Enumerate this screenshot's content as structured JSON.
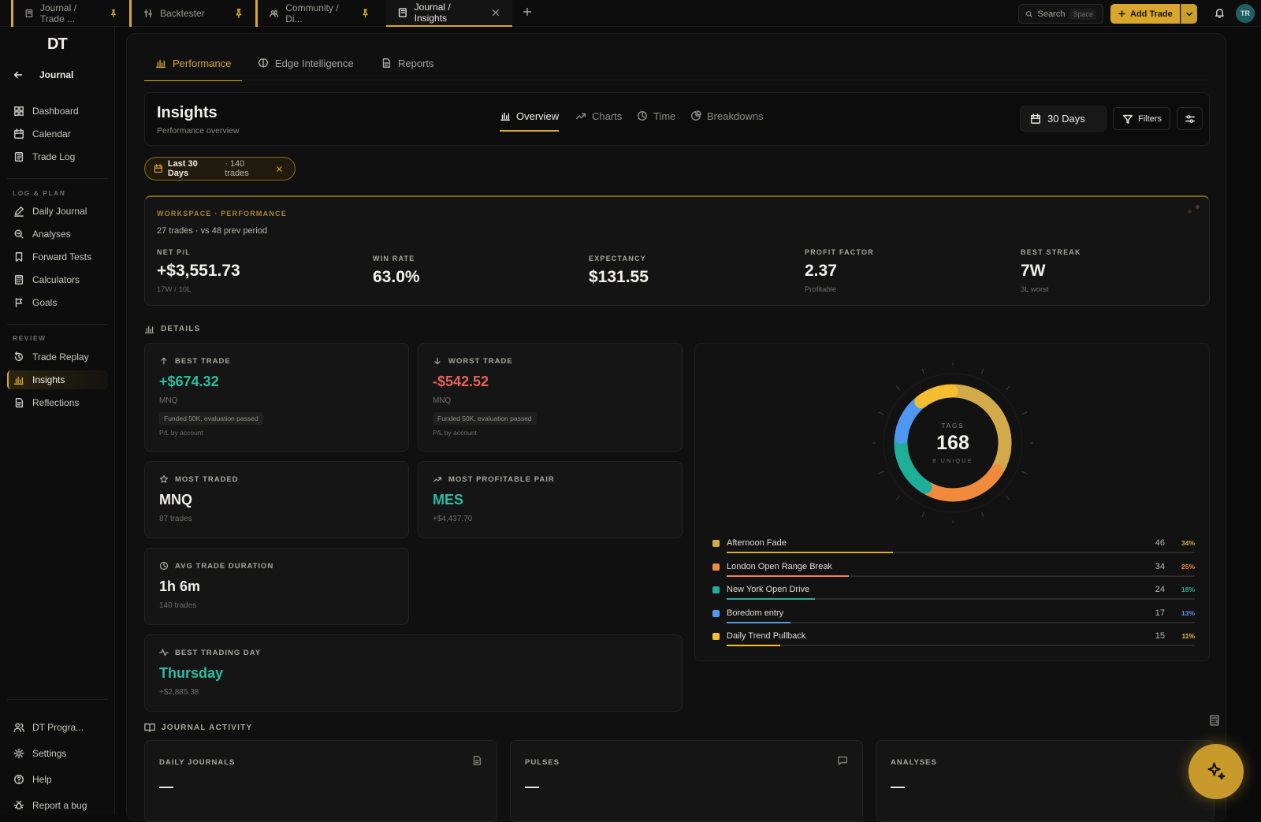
{
  "tabs": [
    {
      "label": "Journal / Trade ...",
      "icon": "journal-icon"
    },
    {
      "label": "Backtester",
      "icon": "backtest-icon"
    },
    {
      "label": "Community / Di...",
      "icon": "community-icon"
    },
    {
      "label": "Journal / Insights",
      "icon": "journal-icon",
      "active": true
    }
  ],
  "topbar": {
    "search_label": "Search",
    "search_kbd": "Space",
    "add_trade": "Add Trade",
    "avatar": "TR"
  },
  "sidebar": {
    "logo": "DT",
    "back_label": "Journal",
    "items": [
      {
        "label": "Dashboard",
        "icon": "dashboard-icon"
      },
      {
        "label": "Calendar",
        "icon": "calendar-icon"
      },
      {
        "label": "Trade Log",
        "icon": "book-icon"
      }
    ],
    "section_log": "LOG & PLAN",
    "log_items": [
      {
        "label": "Daily Journal",
        "icon": "pencil-icon"
      },
      {
        "label": "Analyses",
        "icon": "analysis-icon"
      },
      {
        "label": "Forward Tests",
        "icon": "bookmark-icon"
      },
      {
        "label": "Calculators",
        "icon": "calculator-icon"
      },
      {
        "label": "Goals",
        "icon": "flag-icon"
      }
    ],
    "section_review": "REVIEW",
    "review_items": [
      {
        "label": "Trade Replay",
        "icon": "replay-icon"
      },
      {
        "label": "Insights",
        "icon": "bar-chart-icon",
        "active": true
      },
      {
        "label": "Reflections",
        "icon": "document-icon"
      }
    ],
    "bottom_items": [
      {
        "label": "DT Progra...",
        "icon": "users-icon"
      },
      {
        "label": "Settings",
        "icon": "gear-icon"
      },
      {
        "label": "Help",
        "icon": "help-icon"
      },
      {
        "label": "Report a bug",
        "icon": "bug-icon"
      }
    ]
  },
  "page_tabs": [
    {
      "label": "Performance",
      "icon": "bar-chart-icon",
      "active": true
    },
    {
      "label": "Edge Intelligence",
      "icon": "brain-icon"
    },
    {
      "label": "Reports",
      "icon": "document-icon"
    }
  ],
  "insights": {
    "title": "Insights",
    "subtitle": "Performance overview",
    "subtabs": [
      {
        "label": "Overview",
        "icon": "bar-chart-icon",
        "active": true
      },
      {
        "label": "Charts",
        "icon": "trend-icon"
      },
      {
        "label": "Time",
        "icon": "clock-icon"
      },
      {
        "label": "Breakdowns",
        "icon": "pie-icon"
      }
    ],
    "range": "30 Days",
    "filters": "Filters"
  },
  "chip": {
    "label": "Last 30 Days",
    "detail": "· 140 trades"
  },
  "performance": {
    "kicker": "WORKSPACE · PERFORMANCE",
    "summary": "27 trades · vs 48 prev period",
    "net_pl_label": "NET P/L",
    "net_pl": "+$3,551.73",
    "net_pl_sub": "17W / 10L",
    "win_rate_label": "WIN RATE",
    "win_rate": "63.0%",
    "expectancy_label": "EXPECTANCY",
    "expectancy": "$131.55",
    "profit_factor_label": "PROFIT FACTOR",
    "profit_factor": "2.37",
    "profit_factor_sub": "Profitable",
    "best_streak_label": "BEST STREAK",
    "best_streak": "7W",
    "best_streak_sub": "3L worst"
  },
  "details": {
    "title": "DETAILS",
    "best_trade": {
      "label": "BEST TRADE",
      "value": "+$674.32",
      "symbol": "MNQ",
      "tag": "Funded 50K, evaluation passed",
      "note": "P/L by account"
    },
    "worst_trade": {
      "label": "WORST TRADE",
      "value": "-$542.52",
      "symbol": "MNQ",
      "tag": "Funded 50K, evaluation passed",
      "note": "P/L by account"
    },
    "most_traded": {
      "label": "MOST TRADED",
      "value": "MNQ",
      "sub": "87 trades"
    },
    "most_profitable": {
      "label": "MOST PROFITABLE PAIR",
      "value": "MES",
      "sub": "+$4,437.70"
    },
    "avg_duration": {
      "label": "AVG TRADE DURATION",
      "value": "1h 6m",
      "sub": "140 trades"
    },
    "best_day": {
      "label": "BEST TRADING DAY",
      "value": "Thursday",
      "sub": "+$2,885.38"
    }
  },
  "tags": {
    "label": "TAGS",
    "total": "168",
    "unique": "8 UNIQUE",
    "items": [
      {
        "name": "Afternoon Fade",
        "count": "46",
        "pct": "34%",
        "share": 0.34,
        "color": "#d3aa4a"
      },
      {
        "name": "London Open Range Break",
        "count": "34",
        "pct": "25%",
        "share": 0.25,
        "color": "#f08a3c"
      },
      {
        "name": "New York Open Drive",
        "count": "24",
        "pct": "18%",
        "share": 0.18,
        "color": "#1fae98"
      },
      {
        "name": "Boredom entry",
        "count": "17",
        "pct": "13%",
        "share": 0.13,
        "color": "#4f97ef"
      },
      {
        "name": "Daily Trend Pullback",
        "count": "15",
        "pct": "11%",
        "share": 0.11,
        "color": "#f4be2e"
      }
    ]
  },
  "journal": {
    "title": "JOURNAL ACTIVITY",
    "cards": [
      {
        "label": "DAILY JOURNALS",
        "value": "—",
        "icon": "document-icon"
      },
      {
        "label": "PULSES",
        "value": "—",
        "icon": "chat-icon"
      },
      {
        "label": "ANALYSES",
        "value": "—",
        "icon": ""
      }
    ]
  }
}
